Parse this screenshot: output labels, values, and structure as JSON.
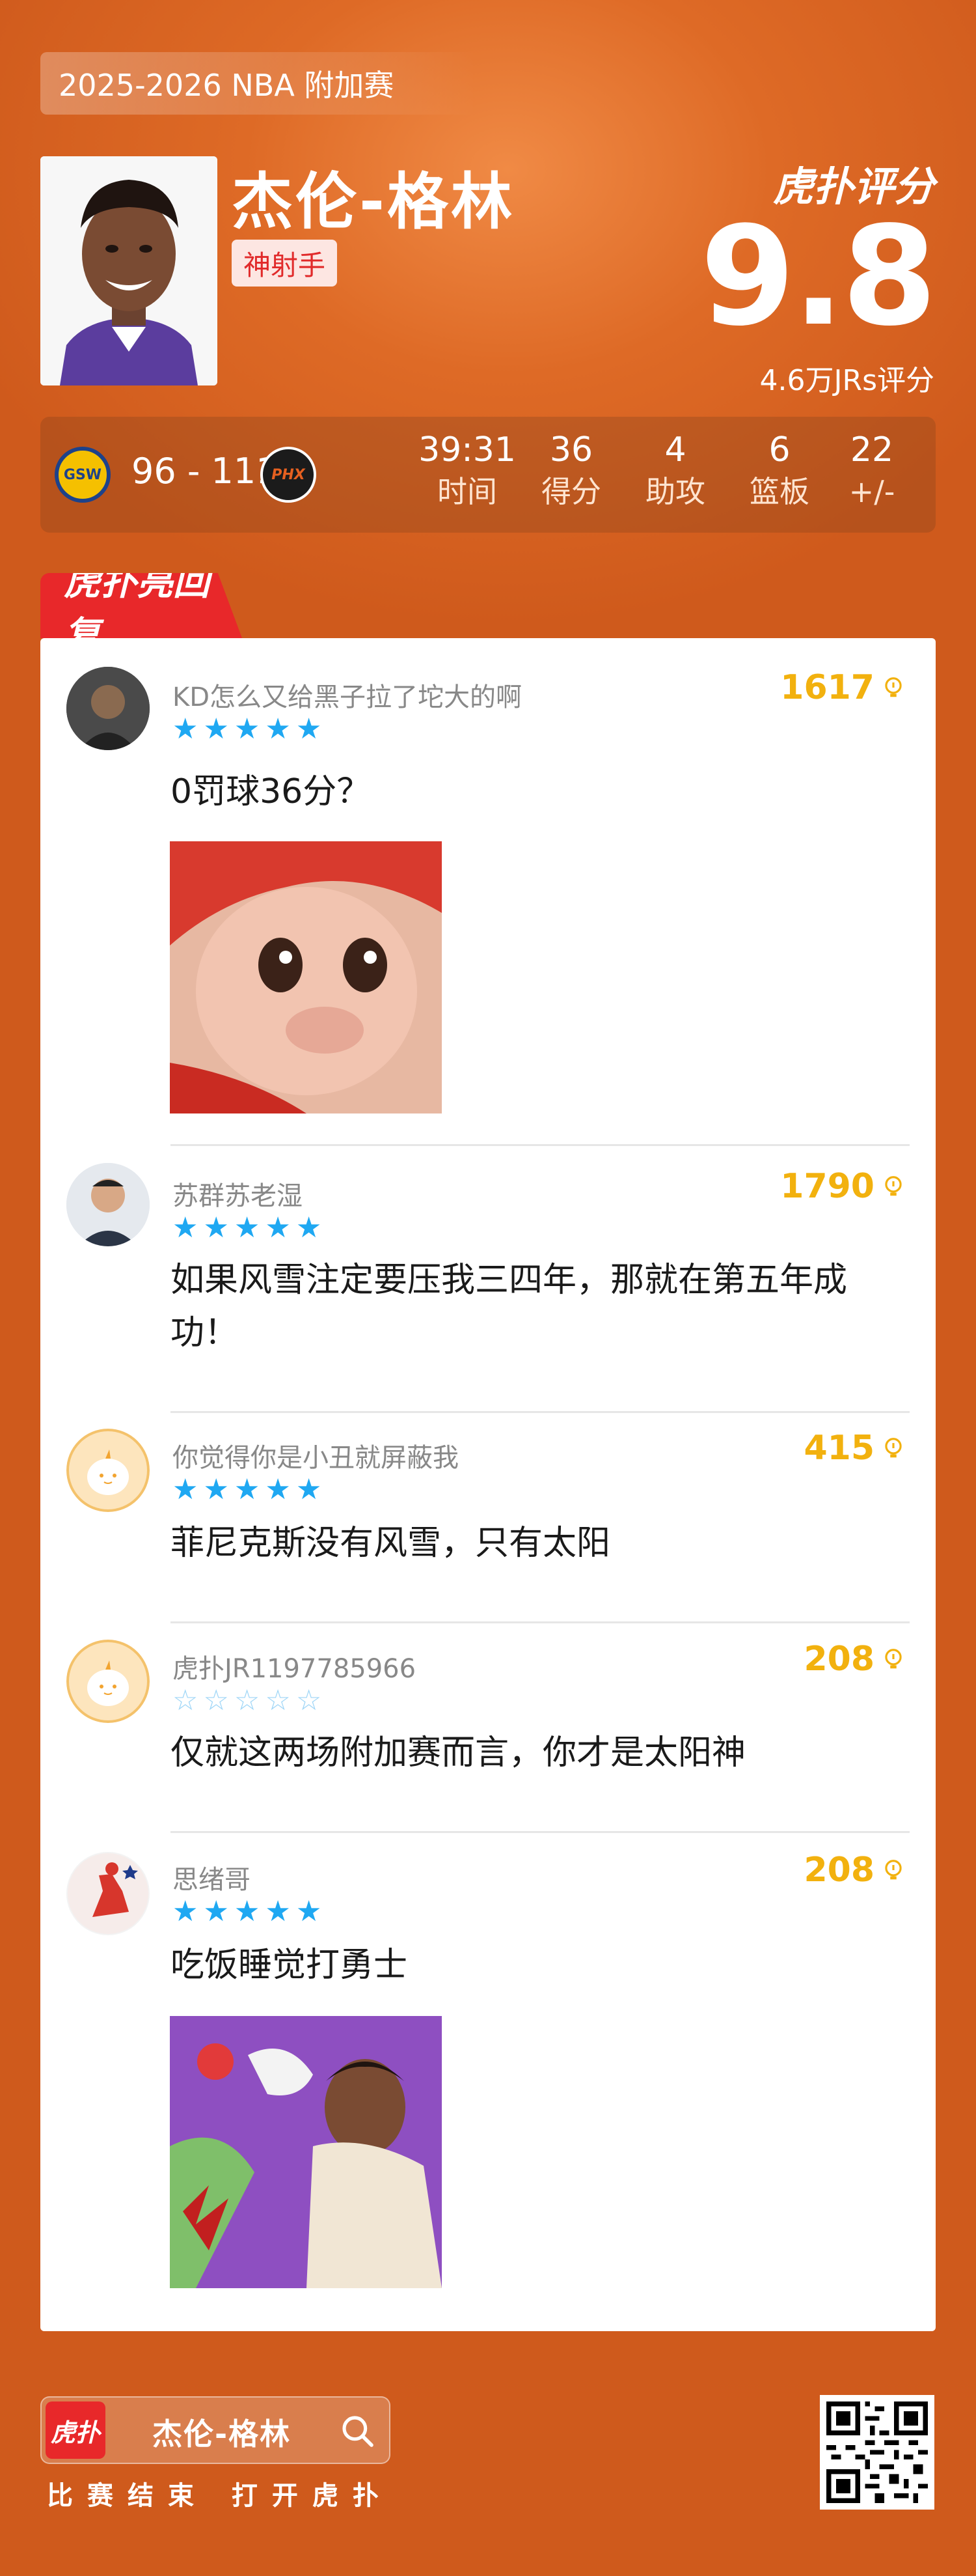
{
  "header": {
    "season": "2025-2026 NBA 附加赛",
    "player_name": "杰伦-格林",
    "player_tag": "神射手",
    "brand": "虎扑评分",
    "rating": "9.8",
    "rating_count": "4.6万JRs评分"
  },
  "game": {
    "home_team": "GSW",
    "away_team": "PHX",
    "score": "96 - 111",
    "stats": [
      {
        "value": "39:31",
        "label": "时间"
      },
      {
        "value": "36",
        "label": "得分"
      },
      {
        "value": "4",
        "label": "助攻"
      },
      {
        "value": "6",
        "label": "篮板"
      },
      {
        "value": "22",
        "label": "+/-"
      }
    ]
  },
  "section": {
    "title": "虎扑亮回复"
  },
  "comments": [
    {
      "user": "KD怎么又给黑子拉了坨大的啊",
      "likes": "1617",
      "stars": 5,
      "text": "0罚球36分？"
    },
    {
      "user": "苏群苏老湿",
      "likes": "1790",
      "stars": 5,
      "text": "如果风雪注定要压我三四年，那就在第五年成功！"
    },
    {
      "user": "你觉得你是小丑就屏蔽我",
      "likes": "415",
      "stars": 5,
      "text": "菲尼克斯没有风雪，只有太阳"
    },
    {
      "user": "虎扑JR1197785966",
      "likes": "208",
      "stars": 0,
      "text": "仅就这两场附加赛而言，你才是太阳神"
    },
    {
      "user": "思绪哥",
      "likes": "208",
      "stars": 5,
      "text": "吃饭睡觉打勇士"
    }
  ],
  "footer": {
    "logo_text": "虎扑",
    "search_name": "杰伦-格林",
    "caption": "比赛结束 打开虎扑"
  },
  "colors": {
    "background": "#d55f1e",
    "accent_red": "#e8282a",
    "like_gold": "#f2b10e",
    "star_blue": "#1fa8f2"
  }
}
